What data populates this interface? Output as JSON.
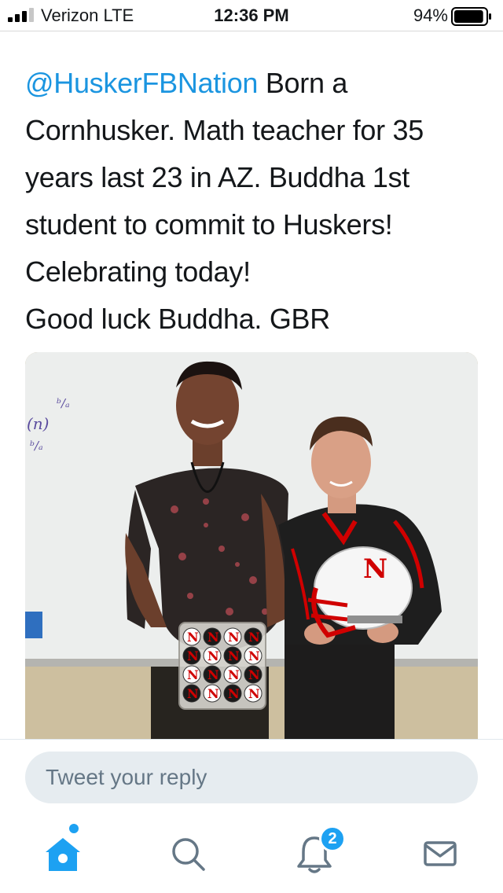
{
  "status_bar": {
    "carrier": "Verizon  LTE",
    "time": "12:36 PM",
    "battery_percent": "94%",
    "battery_level": 0.94,
    "signal_bars": 3
  },
  "tweet": {
    "mention": "@HuskerFBNation",
    "lines": [
      " Born a",
      "Cornhusker.  Math teacher for 35",
      "years last 23 in AZ.  Buddha 1st",
      "student to commit to Huskers!",
      "Celebrating today!",
      "Good luck Buddha. GBR"
    ]
  },
  "photo": {
    "board_writing_1": "ᵇ/ₐ",
    "board_writing_2": "(n)",
    "board_writing_3": "ᵇ/ₐ",
    "cupcake_letter": "N",
    "helmet_letter": "N"
  },
  "reply": {
    "placeholder": "Tweet your reply"
  },
  "tab_bar": {
    "tabs": [
      {
        "name": "home",
        "icon": "home-icon",
        "active": true,
        "has_dot": true
      },
      {
        "name": "search",
        "icon": "search-icon"
      },
      {
        "name": "notifications",
        "icon": "bell-icon",
        "badge": "2"
      },
      {
        "name": "messages",
        "icon": "mail-icon"
      }
    ]
  },
  "colors": {
    "accent": "#1da1f2",
    "mention": "#1b95e0",
    "husker_red": "#d00000"
  }
}
